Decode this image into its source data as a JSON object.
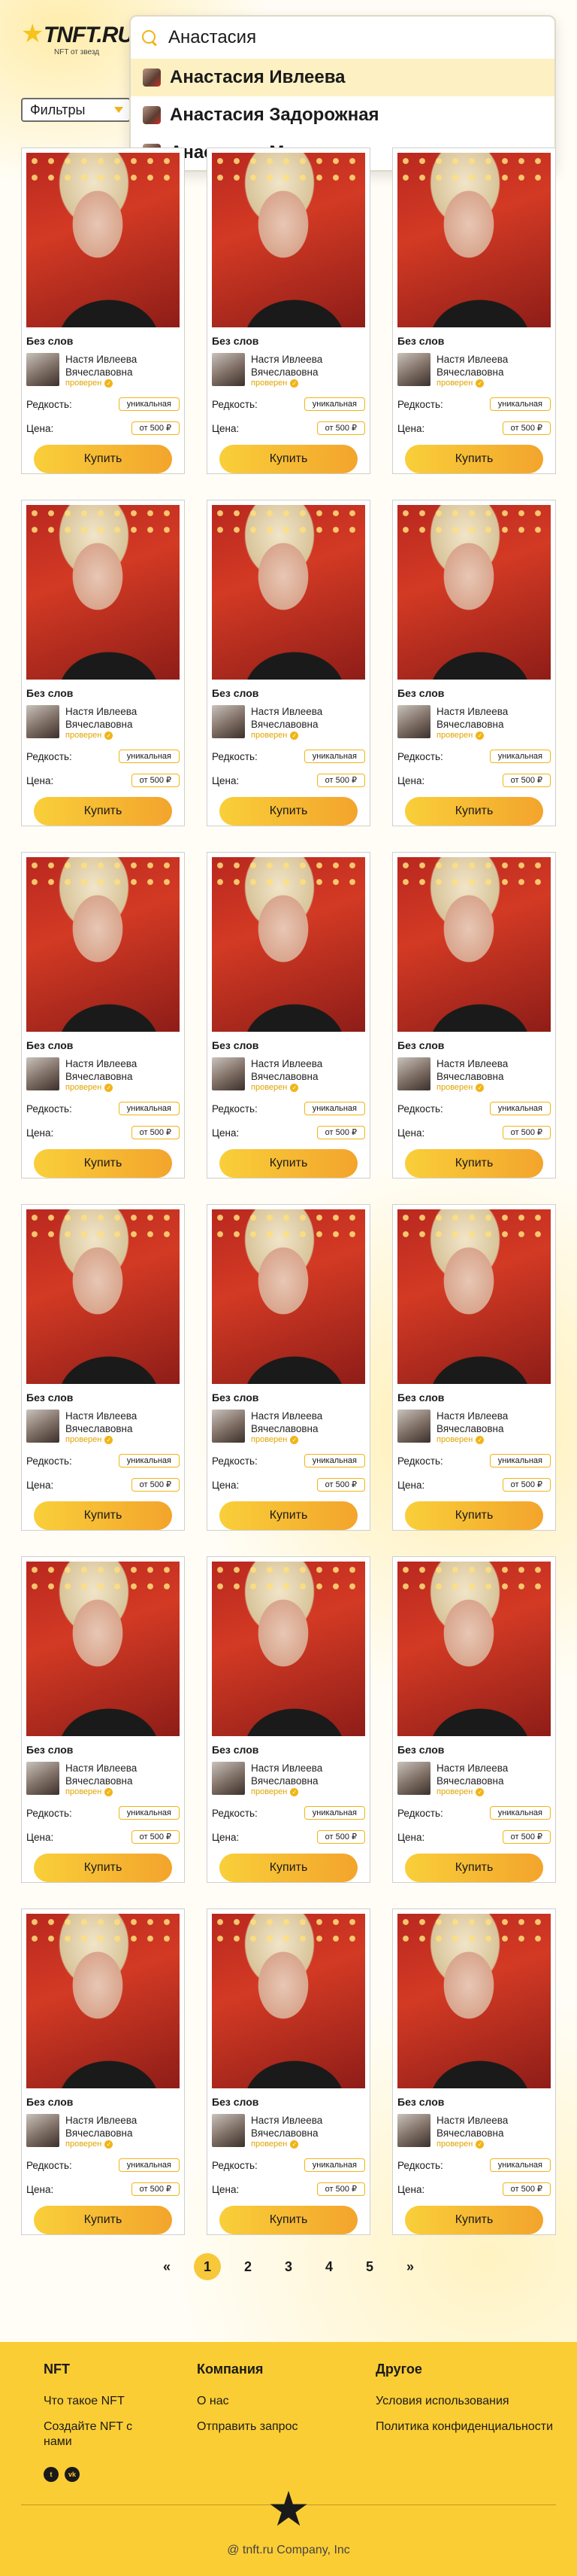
{
  "header": {
    "logo_text": "TNFT.RU",
    "logo_sub": "NFT от звезд",
    "filters_label": "Фильтры"
  },
  "search": {
    "value": "Анастасия",
    "suggestions": [
      "Анастасия Ивлеева",
      "Анастасия Задорожная",
      "Анастасия Макеева"
    ]
  },
  "card": {
    "title": "Без слов",
    "author_first": "Настя Ивлеева",
    "author_last": "Вячеславовна",
    "verified": "проверен",
    "rarity_label": "Редкость:",
    "rarity_value": "уникальная",
    "price_label": "Цена:",
    "price_value": "от 500 ₽",
    "buy_label": "Купить"
  },
  "pagination": {
    "prev": "«",
    "pages": [
      "1",
      "2",
      "3",
      "4",
      "5"
    ],
    "current": "1",
    "next": "»"
  },
  "footer": {
    "nft": {
      "title": "NFT",
      "links": [
        "Что такое NFT",
        "Создайте NFT с нами"
      ]
    },
    "company": {
      "title": "Компания",
      "links": [
        "О нас",
        "Отправить запрос"
      ]
    },
    "other": {
      "title": "Другое",
      "links": [
        "Условия использования",
        "Политика конфиденциальности"
      ]
    },
    "socials": [
      "twitter-icon",
      "vk-icon"
    ],
    "copyright": "@ tnft.ru Company, Inc"
  },
  "colors": {
    "accent": "#f7c83a",
    "footer_bg": "#fbcd34",
    "verified": "#e0a400"
  }
}
